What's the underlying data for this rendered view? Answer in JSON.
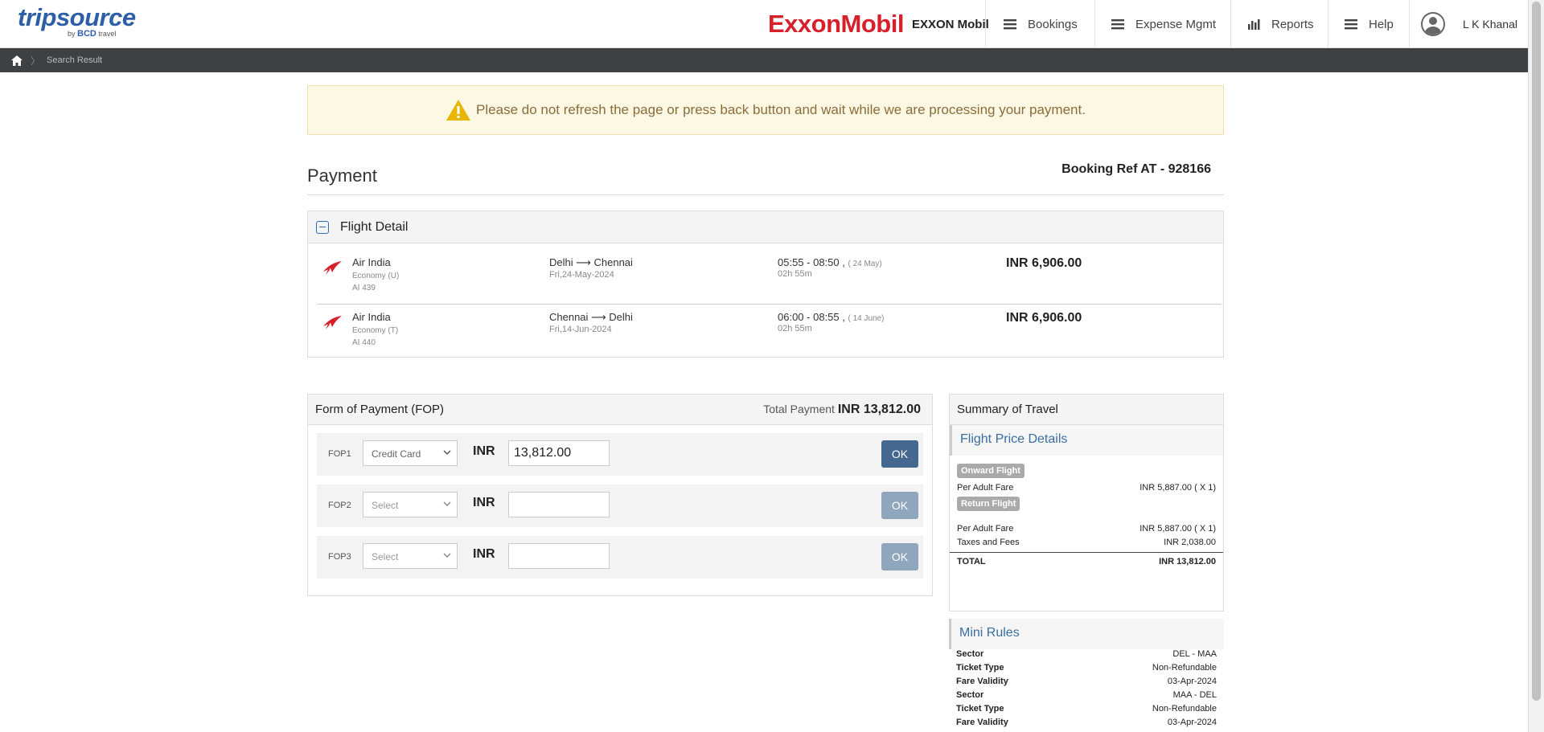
{
  "header": {
    "logo_main": "tripsource",
    "logo_by": "by",
    "logo_brand": "BCD",
    "logo_travel": "travel",
    "company_logo": "ExxonMobil",
    "company_name": "EXXON Mobil",
    "nav": [
      {
        "label": "Bookings",
        "icon": "menu-icon"
      },
      {
        "label": "Expense Mgmt",
        "icon": "menu-icon"
      },
      {
        "label": "Reports",
        "icon": "bar-chart-icon"
      },
      {
        "label": "Help",
        "icon": "menu-icon"
      }
    ],
    "user_name": "L K Khanal"
  },
  "breadcrumb": {
    "current": "Search Result"
  },
  "alert": {
    "message": "Please do not refresh the page or press back button and wait while we are processing your payment."
  },
  "payment": {
    "title": "Payment",
    "booking_ref": "Booking Ref AT - 928166"
  },
  "flight_detail": {
    "title": "Flight Detail",
    "flights": [
      {
        "airline": "Air India",
        "cabin": "Economy (U)",
        "flight_no": "AI 439",
        "route": "Delhi ⟶ Chennai",
        "date": "Fri,24-May-2024",
        "time": "05:55 - 08:50 ,",
        "time_date": "( 24 May)",
        "duration": "02h 55m",
        "price": "INR 6,906.00"
      },
      {
        "airline": "Air India",
        "cabin": "Economy (T)",
        "flight_no": "AI 440",
        "route": "Chennai ⟶ Delhi",
        "date": "Fri,14-Jun-2024",
        "time": "06:00 - 08:55 ,",
        "time_date": "( 14 June)",
        "duration": "02h 55m",
        "price": "INR 6,906.00"
      }
    ]
  },
  "fop": {
    "title": "Form of Payment (FOP)",
    "total_label": "Total Payment",
    "total_value": "INR 13,812.00",
    "rows": [
      {
        "label": "FOP1",
        "select": "Credit Card",
        "currency": "INR",
        "amount": "13,812.00",
        "button": "OK"
      },
      {
        "label": "FOP2",
        "select": "Select",
        "currency": "INR",
        "amount": "",
        "button": "OK"
      },
      {
        "label": "FOP3",
        "select": "Select",
        "currency": "INR",
        "amount": "",
        "button": "OK"
      }
    ]
  },
  "summary": {
    "title": "Summary of Travel",
    "price_title": "Flight Price Details",
    "onward_tag": "Onward Flight",
    "return_tag": "Return Flight",
    "onward_fare_label": "Per Adult Fare",
    "onward_fare_value": "INR 5,887.00 ( X 1)",
    "return_fare_label": "Per Adult Fare",
    "return_fare_value": "INR 5,887.00 ( X 1)",
    "taxes_label": "Taxes and Fees",
    "taxes_value": "INR 2,038.00",
    "total_label": "TOTAL",
    "total_value": "INR 13,812.00"
  },
  "mini_rules": {
    "title": "Mini Rules",
    "rows": [
      {
        "label": "Sector",
        "value": "DEL - MAA"
      },
      {
        "label": "Ticket Type",
        "value": "Non-Refundable"
      },
      {
        "label": "Fare Validity",
        "value": "03-Apr-2024"
      },
      {
        "label": "Sector",
        "value": "MAA - DEL"
      },
      {
        "label": "Ticket Type",
        "value": "Non-Refundable"
      },
      {
        "label": "Fare Validity",
        "value": "03-Apr-2024"
      }
    ]
  },
  "colors": {
    "accent": "#2d5fa8",
    "brand_red": "#d8202a",
    "button": "#44688f",
    "alert_bg": "#fcf8e3"
  }
}
